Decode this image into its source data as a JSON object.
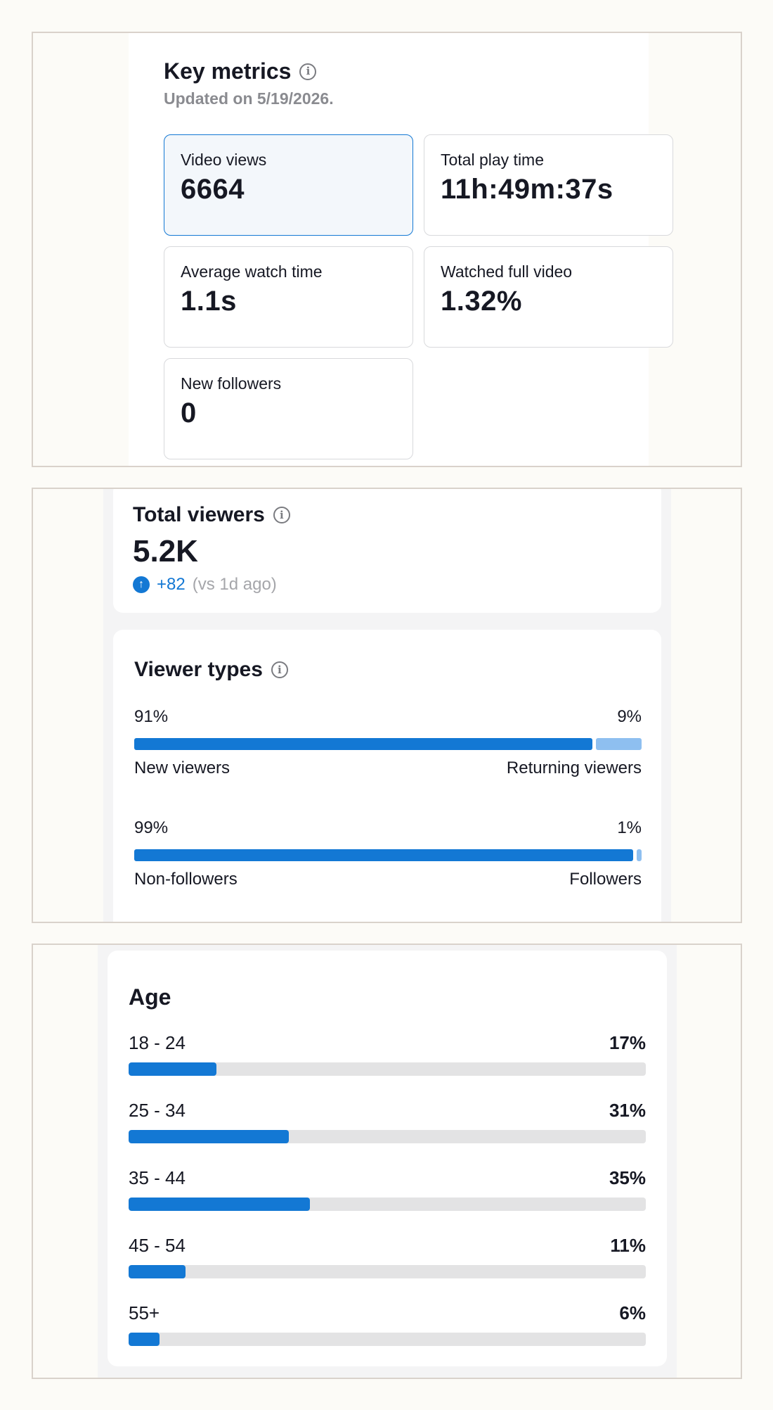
{
  "key_metrics": {
    "title": "Key metrics",
    "updated": "Updated on 5/19/2026.",
    "cards": [
      {
        "label": "Video views",
        "value": "6664",
        "selected": true
      },
      {
        "label": "Total play time",
        "value": "11h:49m:37s",
        "selected": false
      },
      {
        "label": "Average watch time",
        "value": "1.1s",
        "selected": false
      },
      {
        "label": "Watched full video",
        "value": "1.32%",
        "selected": false
      },
      {
        "label": "New followers",
        "value": "0",
        "selected": false
      }
    ]
  },
  "total_viewers": {
    "title": "Total viewers",
    "value": "5.2K",
    "delta": "+82",
    "compare": "(vs 1d ago)"
  },
  "viewer_types": {
    "title": "Viewer types",
    "rows": [
      {
        "left_pct": "91%",
        "right_pct": "9%",
        "left_label": "New viewers",
        "right_label": "Returning viewers",
        "fraction": 0.91
      },
      {
        "left_pct": "99%",
        "right_pct": "1%",
        "left_label": "Non-followers",
        "right_label": "Followers",
        "fraction": 0.99
      }
    ]
  },
  "age": {
    "title": "Age",
    "rows": [
      {
        "range": "18 - 24",
        "pct": "17%",
        "fraction": 0.17
      },
      {
        "range": "25 - 34",
        "pct": "31%",
        "fraction": 0.31
      },
      {
        "range": "35 - 44",
        "pct": "35%",
        "fraction": 0.35
      },
      {
        "range": "45 - 54",
        "pct": "11%",
        "fraction": 0.11
      },
      {
        "range": "55+",
        "pct": "6%",
        "fraction": 0.06
      }
    ]
  },
  "colors": {
    "accent": "#1378d4",
    "accent_light": "#8ebff0",
    "track": "#e3e3e4"
  },
  "icons": {
    "info": "info-circle-icon",
    "up": "arrow-up-circle-icon"
  }
}
